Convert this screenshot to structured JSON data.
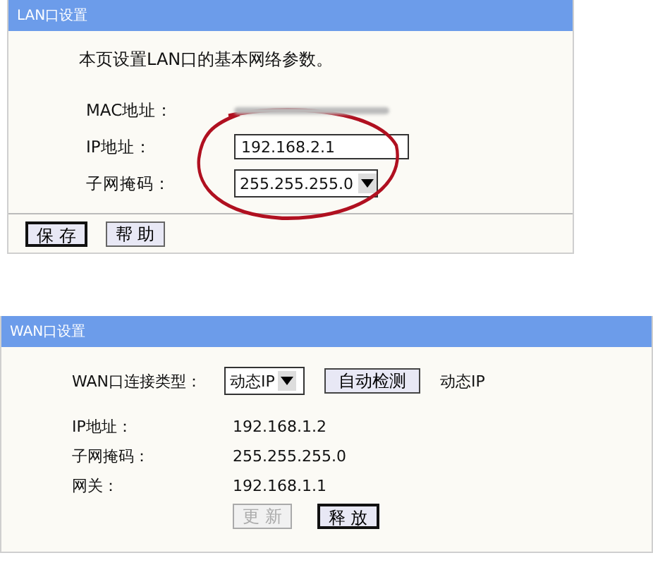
{
  "lan": {
    "title": "LAN口设置",
    "intro": "本页设置LAN口的基本网络参数。",
    "fields": [
      {
        "label": "MAC地址：",
        "kind": "blurred"
      },
      {
        "label": "IP地址：",
        "kind": "input",
        "value": "192.168.2.1"
      },
      {
        "label": "子网掩码：",
        "kind": "select",
        "value": "255.255.255.0"
      }
    ],
    "buttons": [
      {
        "label": "保 存",
        "default": true,
        "disabled": false
      },
      {
        "label": "帮 助",
        "default": false,
        "disabled": false
      }
    ]
  },
  "wan": {
    "title": "WAN口设置",
    "type_row": {
      "label": "WAN口连接类型：",
      "select": "动态IP",
      "button": "自动检测",
      "result": "动态IP"
    },
    "rows": [
      {
        "label": "IP地址：",
        "value": "192.168.1.2"
      },
      {
        "label": "子网掩码：",
        "value": "255.255.255.0"
      },
      {
        "label": "网关：",
        "value": "192.168.1.1"
      }
    ],
    "buttons": [
      {
        "label": "更 新",
        "default": false,
        "disabled": true
      },
      {
        "label": "释 放",
        "default": true,
        "disabled": false
      }
    ]
  }
}
